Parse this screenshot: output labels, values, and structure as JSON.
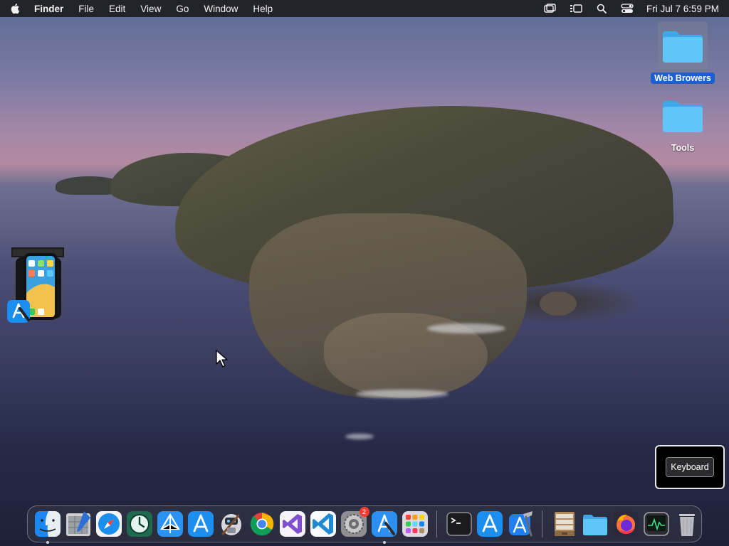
{
  "menubar": {
    "app_name": "Finder",
    "menus": [
      "File",
      "Edit",
      "View",
      "Go",
      "Window",
      "Help"
    ],
    "clock": "Fri Jul 7  6:59 PM",
    "status_icons": [
      "screen-mirroring-icon",
      "stage-manager-icon",
      "spotlight-search-icon",
      "control-center-icon"
    ]
  },
  "desktop": {
    "icons": [
      {
        "label": "Web Browers",
        "icon": "folder-icon",
        "selected": true
      },
      {
        "label": "Tools",
        "icon": "folder-icon",
        "selected": false
      }
    ],
    "floating_app": "simulator-icon"
  },
  "keyboard_panel": {
    "button_label": "Keyboard"
  },
  "dock": {
    "items": [
      {
        "name": "finder",
        "icon": "finder-icon",
        "running": true
      },
      {
        "name": "preview-editor",
        "icon": "preview-icon",
        "running": false
      },
      {
        "name": "safari",
        "icon": "safari-icon",
        "running": false
      },
      {
        "name": "time-machine",
        "icon": "time-machine-icon",
        "running": false
      },
      {
        "name": "app-store-connect",
        "icon": "app-store-connect-icon",
        "running": false
      },
      {
        "name": "app-store",
        "icon": "app-store-icon",
        "running": false
      },
      {
        "name": "automator",
        "icon": "automator-icon",
        "running": false
      },
      {
        "name": "chrome",
        "icon": "chrome-icon",
        "running": false
      },
      {
        "name": "visual-studio",
        "icon": "visual-studio-icon",
        "running": false
      },
      {
        "name": "vscode",
        "icon": "vscode-icon",
        "running": false
      },
      {
        "name": "system-settings",
        "icon": "system-settings-icon",
        "running": false,
        "badge": "2"
      },
      {
        "name": "xcode-simulator",
        "icon": "simulator-icon",
        "running": true
      },
      {
        "name": "launchpad",
        "icon": "launchpad-icon",
        "running": false
      },
      {
        "name": "terminal",
        "icon": "terminal-icon",
        "running": false
      },
      {
        "name": "app-store-2",
        "icon": "app-store-icon",
        "running": false
      },
      {
        "name": "xcode",
        "icon": "xcode-icon",
        "running": false
      },
      {
        "name": "archive",
        "icon": "archive-icon",
        "running": false
      },
      {
        "name": "folder",
        "icon": "folder-icon",
        "running": false
      },
      {
        "name": "firefox",
        "icon": "firefox-icon",
        "running": false
      },
      {
        "name": "activity-monitor",
        "icon": "activity-monitor-icon",
        "running": false
      },
      {
        "name": "trash",
        "icon": "trash-icon",
        "running": false
      }
    ]
  },
  "colors": {
    "menubar_bg": "#1e1e22",
    "selection_blue": "#1d5fd0",
    "folder_blue": "#5cc3f5",
    "badge_red": "#ff3b30"
  }
}
